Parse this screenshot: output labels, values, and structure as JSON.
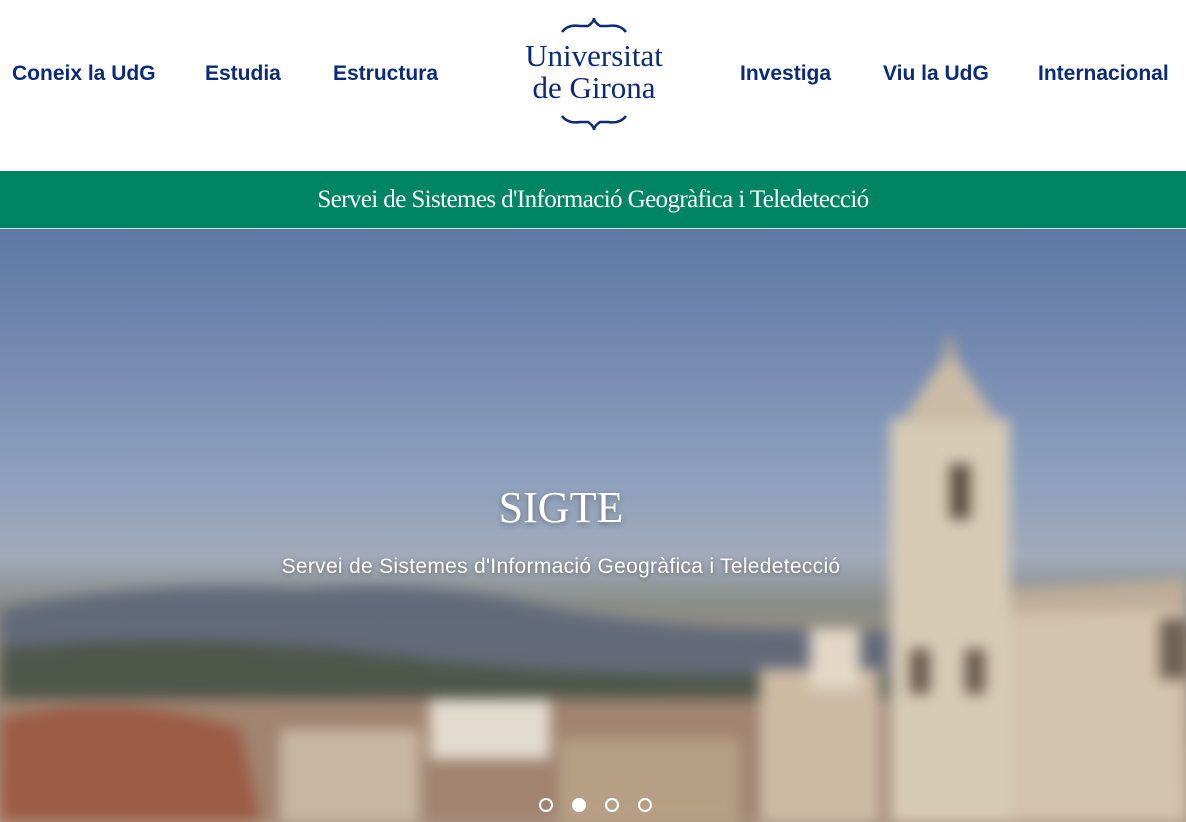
{
  "nav": {
    "left": [
      "Coneix la UdG",
      "Estudia",
      "Estructura"
    ],
    "right": [
      "Investiga",
      "Viu la UdG",
      "Internacional"
    ]
  },
  "logo": {
    "line1": "Universitat",
    "line2": "de Girona"
  },
  "banner": {
    "text": "Servei de Sistemes d'Informació Geogràfica i Teledetecció"
  },
  "hero": {
    "title": "SIGTE",
    "subtitle": "Servei de Sistemes d'Informació Geogràfica i Teledetecció",
    "slide_count": 4,
    "active_slide": 2
  },
  "colors": {
    "brand_blue": "#0a2a7a",
    "banner_green": "#008564"
  },
  "icons": {
    "slider_dot": "circle-outline",
    "slider_dot_active": "circle-filled"
  }
}
